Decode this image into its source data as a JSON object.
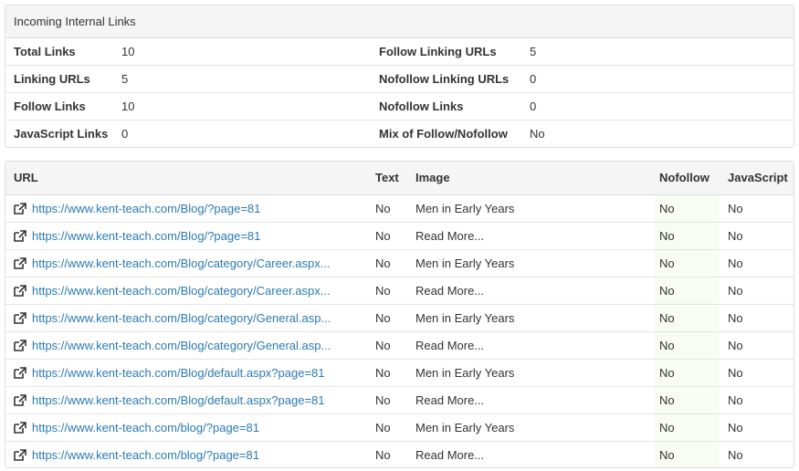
{
  "summary": {
    "title": "Incoming Internal Links",
    "rows": [
      {
        "label_a": "Total Links",
        "value_a": "10",
        "label_b": "Follow Linking URLs",
        "value_b": "5"
      },
      {
        "label_a": "Linking URLs",
        "value_a": "5",
        "label_b": "Nofollow Linking URLs",
        "value_b": "0"
      },
      {
        "label_a": "Follow Links",
        "value_a": "10",
        "label_b": "Nofollow Links",
        "value_b": "0"
      },
      {
        "label_a": "JavaScript Links",
        "value_a": "0",
        "label_b": "Mix of Follow/Nofollow",
        "value_b": "No"
      }
    ]
  },
  "links_table": {
    "columns": {
      "url": "URL",
      "text": "Text",
      "image": "Image",
      "nofollow": "Nofollow",
      "javascript": "JavaScript"
    },
    "rows": [
      {
        "url": "https://www.kent-teach.com/Blog/?page=81",
        "text": "No",
        "image": "Men in Early Years",
        "nofollow": "No",
        "javascript": "No"
      },
      {
        "url": "https://www.kent-teach.com/Blog/?page=81",
        "text": "No",
        "image": "Read More...",
        "nofollow": "No",
        "javascript": "No"
      },
      {
        "url": "https://www.kent-teach.com/Blog/category/Career.aspx...",
        "text": "No",
        "image": "Men in Early Years",
        "nofollow": "No",
        "javascript": "No"
      },
      {
        "url": "https://www.kent-teach.com/Blog/category/Career.aspx...",
        "text": "No",
        "image": "Read More...",
        "nofollow": "No",
        "javascript": "No"
      },
      {
        "url": "https://www.kent-teach.com/Blog/category/General.asp...",
        "text": "No",
        "image": "Men in Early Years",
        "nofollow": "No",
        "javascript": "No"
      },
      {
        "url": "https://www.kent-teach.com/Blog/category/General.asp...",
        "text": "No",
        "image": "Read More...",
        "nofollow": "No",
        "javascript": "No"
      },
      {
        "url": "https://www.kent-teach.com/Blog/default.aspx?page=81",
        "text": "No",
        "image": "Men in Early Years",
        "nofollow": "No",
        "javascript": "No"
      },
      {
        "url": "https://www.kent-teach.com/Blog/default.aspx?page=81",
        "text": "No",
        "image": "Read More...",
        "nofollow": "No",
        "javascript": "No"
      },
      {
        "url": "https://www.kent-teach.com/blog/?page=81",
        "text": "No",
        "image": "Men in Early Years",
        "nofollow": "No",
        "javascript": "No"
      },
      {
        "url": "https://www.kent-teach.com/blog/?page=81",
        "text": "No",
        "image": "Read More...",
        "nofollow": "No",
        "javascript": "No"
      }
    ]
  },
  "icons": {
    "row_link_icon": "external-link-icon"
  },
  "colors": {
    "link": "#2a7ab5",
    "heading_bg": "#f5f5f5",
    "nofollow_bg": "#f8fcf3"
  }
}
